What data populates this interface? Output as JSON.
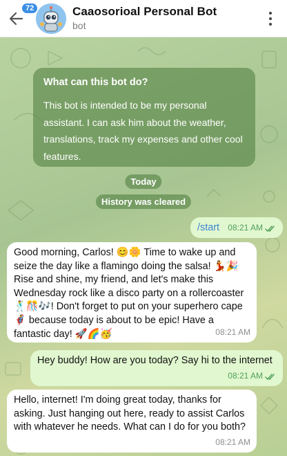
{
  "header": {
    "back_badge": "72",
    "title": "Caaosorioal Personal Bot",
    "subtitle": "bot"
  },
  "info_card": {
    "heading": "What can this bot do?",
    "body": "This bot is intended to be my personal assistant. I can ask him about the weather, translations, track my expenses and other cool features."
  },
  "service": {
    "date": "Today",
    "history": "History was cleared"
  },
  "messages": [
    {
      "from": "me",
      "text": "/start",
      "time": "08:21 AM",
      "read": true
    },
    {
      "from": "bot",
      "text": "Good morning, Carlos! 😊🌼 Time to wake up and seize the day like a flamingo doing the salsa! 💃🎉 Rise and shine, my friend, and let's make this Wednesday rock like a disco party on a rollercoaster 🕺🎊🎶! Don't forget to put on your superhero cape 🦸 because today is about to be epic! Have a fantastic day! 🚀🌈🥳",
      "time": "08:21 AM"
    },
    {
      "from": "me",
      "text": "Hey buddy! How are you today? Say hi to the internet",
      "time": "08:21 AM",
      "read": true
    },
    {
      "from": "bot",
      "text": "Hello, internet! I'm doing great today, thanks for asking. Just hanging out here, ready to assist Carlos with whatever he needs. What can I do for you both?",
      "time": "08:21 AM"
    }
  ],
  "colors": {
    "accent": "#3a8ee6",
    "outgoing_bubble": "#e1f7cf",
    "incoming_bubble": "#ffffff",
    "service_bg": "#568246"
  },
  "icons": [
    "back-arrow-icon",
    "bot-avatar",
    "more-vert-icon",
    "double-check-icon"
  ]
}
